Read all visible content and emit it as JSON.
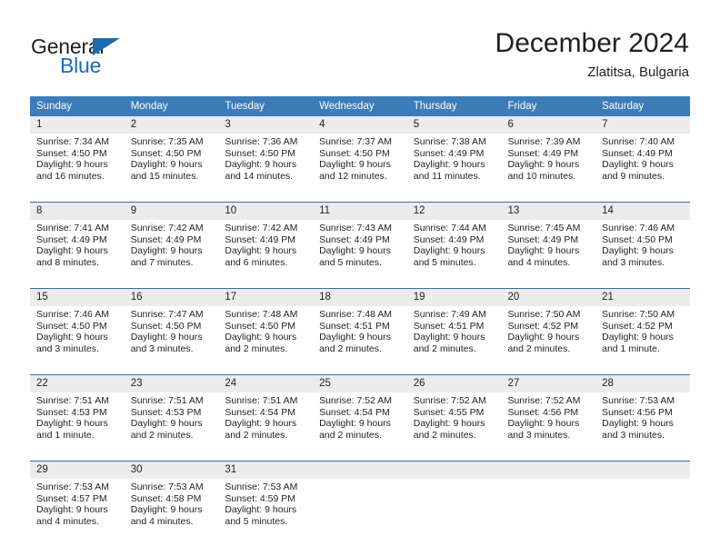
{
  "brand": {
    "name_dark": "General",
    "name_blue": "Blue",
    "accent_color": "#1b6cb0"
  },
  "header": {
    "title": "December 2024",
    "location": "Zlatitsa, Bulgaria"
  },
  "colors": {
    "header_blue": "#3b7cb9",
    "week_separator": "#2f6ea8",
    "daynum_band": "#ececec",
    "text": "#231f20"
  },
  "calendar": {
    "weekday_headers": [
      "Sunday",
      "Monday",
      "Tuesday",
      "Wednesday",
      "Thursday",
      "Friday",
      "Saturday"
    ],
    "weeks": [
      [
        {
          "day": "1",
          "sunrise": "Sunrise: 7:34 AM",
          "sunset": "Sunset: 4:50 PM",
          "daylight_line1": "Daylight: 9 hours",
          "daylight_line2": "and 16 minutes."
        },
        {
          "day": "2",
          "sunrise": "Sunrise: 7:35 AM",
          "sunset": "Sunset: 4:50 PM",
          "daylight_line1": "Daylight: 9 hours",
          "daylight_line2": "and 15 minutes."
        },
        {
          "day": "3",
          "sunrise": "Sunrise: 7:36 AM",
          "sunset": "Sunset: 4:50 PM",
          "daylight_line1": "Daylight: 9 hours",
          "daylight_line2": "and 14 minutes."
        },
        {
          "day": "4",
          "sunrise": "Sunrise: 7:37 AM",
          "sunset": "Sunset: 4:50 PM",
          "daylight_line1": "Daylight: 9 hours",
          "daylight_line2": "and 12 minutes."
        },
        {
          "day": "5",
          "sunrise": "Sunrise: 7:38 AM",
          "sunset": "Sunset: 4:49 PM",
          "daylight_line1": "Daylight: 9 hours",
          "daylight_line2": "and 11 minutes."
        },
        {
          "day": "6",
          "sunrise": "Sunrise: 7:39 AM",
          "sunset": "Sunset: 4:49 PM",
          "daylight_line1": "Daylight: 9 hours",
          "daylight_line2": "and 10 minutes."
        },
        {
          "day": "7",
          "sunrise": "Sunrise: 7:40 AM",
          "sunset": "Sunset: 4:49 PM",
          "daylight_line1": "Daylight: 9 hours",
          "daylight_line2": "and 9 minutes."
        }
      ],
      [
        {
          "day": "8",
          "sunrise": "Sunrise: 7:41 AM",
          "sunset": "Sunset: 4:49 PM",
          "daylight_line1": "Daylight: 9 hours",
          "daylight_line2": "and 8 minutes."
        },
        {
          "day": "9",
          "sunrise": "Sunrise: 7:42 AM",
          "sunset": "Sunset: 4:49 PM",
          "daylight_line1": "Daylight: 9 hours",
          "daylight_line2": "and 7 minutes."
        },
        {
          "day": "10",
          "sunrise": "Sunrise: 7:42 AM",
          "sunset": "Sunset: 4:49 PM",
          "daylight_line1": "Daylight: 9 hours",
          "daylight_line2": "and 6 minutes."
        },
        {
          "day": "11",
          "sunrise": "Sunrise: 7:43 AM",
          "sunset": "Sunset: 4:49 PM",
          "daylight_line1": "Daylight: 9 hours",
          "daylight_line2": "and 5 minutes."
        },
        {
          "day": "12",
          "sunrise": "Sunrise: 7:44 AM",
          "sunset": "Sunset: 4:49 PM",
          "daylight_line1": "Daylight: 9 hours",
          "daylight_line2": "and 5 minutes."
        },
        {
          "day": "13",
          "sunrise": "Sunrise: 7:45 AM",
          "sunset": "Sunset: 4:49 PM",
          "daylight_line1": "Daylight: 9 hours",
          "daylight_line2": "and 4 minutes."
        },
        {
          "day": "14",
          "sunrise": "Sunrise: 7:46 AM",
          "sunset": "Sunset: 4:50 PM",
          "daylight_line1": "Daylight: 9 hours",
          "daylight_line2": "and 3 minutes."
        }
      ],
      [
        {
          "day": "15",
          "sunrise": "Sunrise: 7:46 AM",
          "sunset": "Sunset: 4:50 PM",
          "daylight_line1": "Daylight: 9 hours",
          "daylight_line2": "and 3 minutes."
        },
        {
          "day": "16",
          "sunrise": "Sunrise: 7:47 AM",
          "sunset": "Sunset: 4:50 PM",
          "daylight_line1": "Daylight: 9 hours",
          "daylight_line2": "and 3 minutes."
        },
        {
          "day": "17",
          "sunrise": "Sunrise: 7:48 AM",
          "sunset": "Sunset: 4:50 PM",
          "daylight_line1": "Daylight: 9 hours",
          "daylight_line2": "and 2 minutes."
        },
        {
          "day": "18",
          "sunrise": "Sunrise: 7:48 AM",
          "sunset": "Sunset: 4:51 PM",
          "daylight_line1": "Daylight: 9 hours",
          "daylight_line2": "and 2 minutes."
        },
        {
          "day": "19",
          "sunrise": "Sunrise: 7:49 AM",
          "sunset": "Sunset: 4:51 PM",
          "daylight_line1": "Daylight: 9 hours",
          "daylight_line2": "and 2 minutes."
        },
        {
          "day": "20",
          "sunrise": "Sunrise: 7:50 AM",
          "sunset": "Sunset: 4:52 PM",
          "daylight_line1": "Daylight: 9 hours",
          "daylight_line2": "and 2 minutes."
        },
        {
          "day": "21",
          "sunrise": "Sunrise: 7:50 AM",
          "sunset": "Sunset: 4:52 PM",
          "daylight_line1": "Daylight: 9 hours",
          "daylight_line2": "and 1 minute."
        }
      ],
      [
        {
          "day": "22",
          "sunrise": "Sunrise: 7:51 AM",
          "sunset": "Sunset: 4:53 PM",
          "daylight_line1": "Daylight: 9 hours",
          "daylight_line2": "and 1 minute."
        },
        {
          "day": "23",
          "sunrise": "Sunrise: 7:51 AM",
          "sunset": "Sunset: 4:53 PM",
          "daylight_line1": "Daylight: 9 hours",
          "daylight_line2": "and 2 minutes."
        },
        {
          "day": "24",
          "sunrise": "Sunrise: 7:51 AM",
          "sunset": "Sunset: 4:54 PM",
          "daylight_line1": "Daylight: 9 hours",
          "daylight_line2": "and 2 minutes."
        },
        {
          "day": "25",
          "sunrise": "Sunrise: 7:52 AM",
          "sunset": "Sunset: 4:54 PM",
          "daylight_line1": "Daylight: 9 hours",
          "daylight_line2": "and 2 minutes."
        },
        {
          "day": "26",
          "sunrise": "Sunrise: 7:52 AM",
          "sunset": "Sunset: 4:55 PM",
          "daylight_line1": "Daylight: 9 hours",
          "daylight_line2": "and 2 minutes."
        },
        {
          "day": "27",
          "sunrise": "Sunrise: 7:52 AM",
          "sunset": "Sunset: 4:56 PM",
          "daylight_line1": "Daylight: 9 hours",
          "daylight_line2": "and 3 minutes."
        },
        {
          "day": "28",
          "sunrise": "Sunrise: 7:53 AM",
          "sunset": "Sunset: 4:56 PM",
          "daylight_line1": "Daylight: 9 hours",
          "daylight_line2": "and 3 minutes."
        }
      ],
      [
        {
          "day": "29",
          "sunrise": "Sunrise: 7:53 AM",
          "sunset": "Sunset: 4:57 PM",
          "daylight_line1": "Daylight: 9 hours",
          "daylight_line2": "and 4 minutes."
        },
        {
          "day": "30",
          "sunrise": "Sunrise: 7:53 AM",
          "sunset": "Sunset: 4:58 PM",
          "daylight_line1": "Daylight: 9 hours",
          "daylight_line2": "and 4 minutes."
        },
        {
          "day": "31",
          "sunrise": "Sunrise: 7:53 AM",
          "sunset": "Sunset: 4:59 PM",
          "daylight_line1": "Daylight: 9 hours",
          "daylight_line2": "and 5 minutes."
        },
        {
          "day": "",
          "sunrise": "",
          "sunset": "",
          "daylight_line1": "",
          "daylight_line2": ""
        },
        {
          "day": "",
          "sunrise": "",
          "sunset": "",
          "daylight_line1": "",
          "daylight_line2": ""
        },
        {
          "day": "",
          "sunrise": "",
          "sunset": "",
          "daylight_line1": "",
          "daylight_line2": ""
        },
        {
          "day": "",
          "sunrise": "",
          "sunset": "",
          "daylight_line1": "",
          "daylight_line2": ""
        }
      ]
    ]
  }
}
